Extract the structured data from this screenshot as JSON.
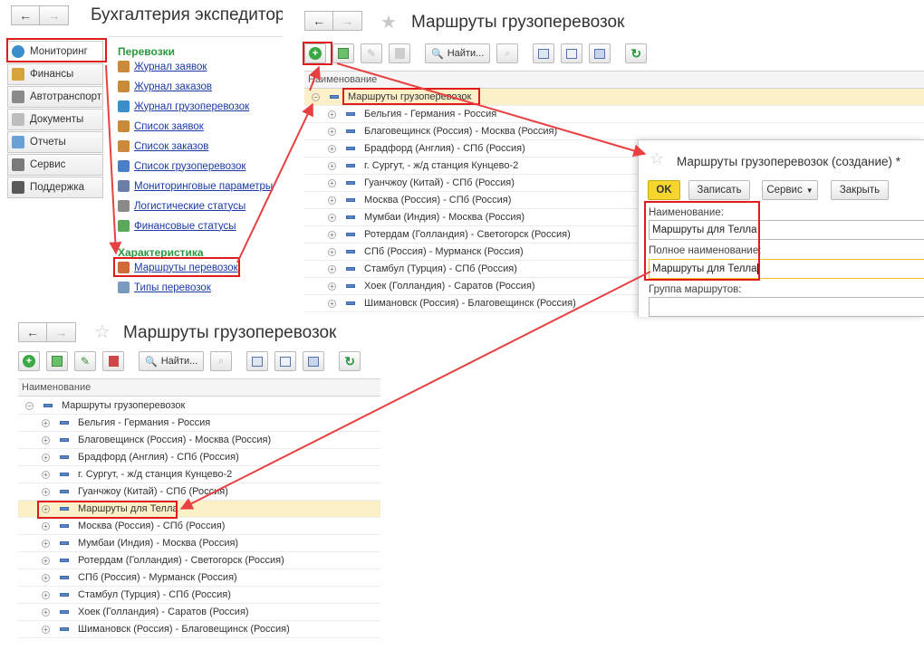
{
  "nav": {
    "back": "←",
    "forward": "→"
  },
  "main_window": {
    "title": "Бухгалтерия экспедитор",
    "sidebar": [
      {
        "label": "Мониторинг",
        "icon": "globe-icon"
      },
      {
        "label": "Финансы",
        "icon": "finance-icon"
      },
      {
        "label": "Автотранспорт",
        "icon": "truck-icon"
      },
      {
        "label": "Документы",
        "icon": "document-icon"
      },
      {
        "label": "Отчеты",
        "icon": "report-icon"
      },
      {
        "label": "Сервис",
        "icon": "gear-icon"
      },
      {
        "label": "Поддержка",
        "icon": "headset-icon"
      }
    ],
    "section1_title": "Перевозки",
    "section1_links": [
      {
        "label": "Журнал заявок",
        "color": "#c98a3a"
      },
      {
        "label": "Журнал заказов",
        "color": "#c98a3a"
      },
      {
        "label": "Журнал грузоперевозок",
        "color": "#3a8ec9"
      },
      {
        "label": "Список заявок",
        "color": "#c98a3a"
      },
      {
        "label": "Список заказов",
        "color": "#c98a3a"
      },
      {
        "label": "Список грузоперевозок",
        "color": "#4a7fc8"
      },
      {
        "label": "Мониторинговые параметры",
        "color": "#6a7fa8"
      },
      {
        "label": "Логистические статусы",
        "color": "#8a8a8a"
      },
      {
        "label": "Финансовые статусы",
        "color": "#5aa85a"
      }
    ],
    "section2_title": "Характеристика",
    "section2_links": [
      {
        "label": "Маршруты перевозок",
        "color": "#d06a3a"
      },
      {
        "label": "Типы перевозок",
        "color": "#7a9ac0"
      }
    ]
  },
  "list_top": {
    "title": "Маршруты грузоперевозок",
    "find_label": "Найти...",
    "column_header": "Наименование",
    "group_label": "Маршруты грузоперевозок",
    "rows": [
      "Бельгия - Германия - Россия",
      "Благовещинск (Россия) - Москва (Россия)",
      "Брадфорд (Англия) - СПб (Россия)",
      "г. Сургут, - ж/д станция Кунцево-2",
      "Гуанчжоу (Китай) - СПб (Россия)",
      "Москва (Россия) - СПб (Россия)",
      "Мумбаи (Индия) - Москва (Россия)",
      "Ротердам (Голландия) - Светогорск (Россия)",
      "СПб (Россия) - Мурманск (Россия)",
      "Стамбул (Турция) - СПб (Россия)",
      "Хоек (Голландия) - Саратов (Россия)",
      "Шимановск (Россия) - Благовещинск (Россия)"
    ]
  },
  "dialog": {
    "title": "Маршруты грузоперевозок (создание) *",
    "ok_label": "OK",
    "save_label": "Записать",
    "service_label": "Сервис",
    "close_label": "Закрыть",
    "name_label": "Наименование:",
    "name_value": "Маршруты для Телла",
    "full_name_label": "Полное наименование:",
    "full_name_value": "Маршруты для Телла",
    "group_label": "Группа маршрутов:",
    "group_value": ""
  },
  "list_bottom": {
    "title": "Маршруты грузоперевозок",
    "find_label": "Найти...",
    "column_header": "Наименование",
    "group_label": "Маршруты грузоперевозок",
    "rows": [
      "Бельгия - Германия - Россия",
      "Благовещинск (Россия) - Москва (Россия)",
      "Брадфорд (Англия) - СПб (Россия)",
      "г. Сургут, - ж/д станция Кунцево-2",
      "Гуанчжоу (Китай) - СПб (Россия)",
      "Маршруты для Телла",
      "Москва (Россия) - СПб (Россия)",
      "Мумбаи (Индия) - Москва (Россия)",
      "Ротердам (Голландия) - Светогорск (Россия)",
      "СПб (Россия) - Мурманск (Россия)",
      "Стамбул (Турция) - СПб (Россия)",
      "Хоек (Голландия) - Саратов (Россия)",
      "Шимановск (Россия) - Благовещинск (Россия)"
    ]
  },
  "colors": {
    "highlight": "#e01b1b",
    "green_accent": "#2a9a3e",
    "link": "#1a3aa8",
    "selected_row": "#fbf0c8"
  }
}
